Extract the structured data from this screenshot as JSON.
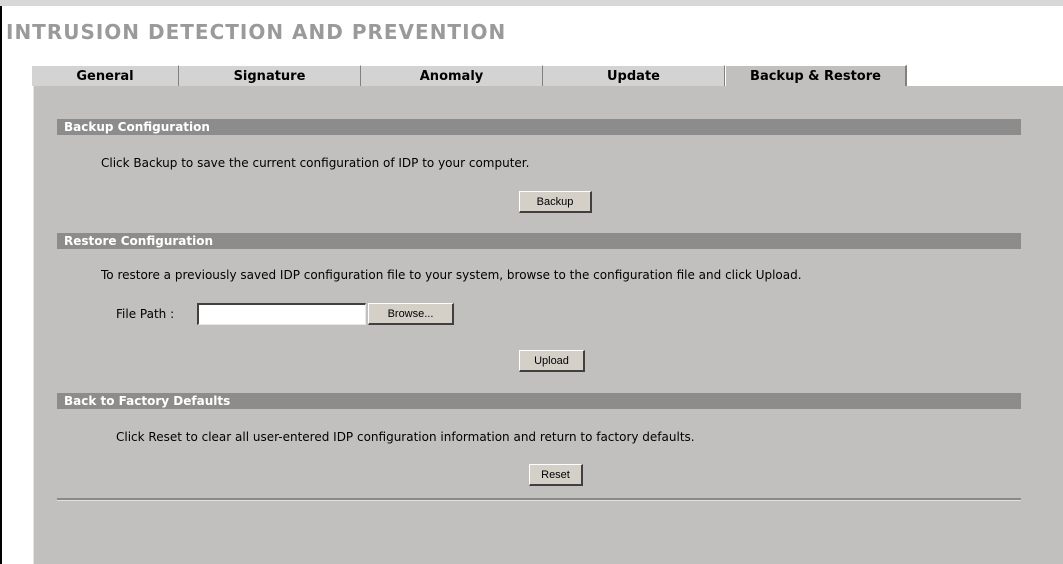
{
  "page": {
    "title": "INTRUSION DETECTION AND PREVENTION"
  },
  "tabs": [
    {
      "label": "General"
    },
    {
      "label": "Signature"
    },
    {
      "label": "Anomaly"
    },
    {
      "label": "Update"
    },
    {
      "label": "Backup & Restore",
      "active": true
    }
  ],
  "backup": {
    "header": "Backup Configuration",
    "description": "Click Backup to save the current configuration of IDP to your computer.",
    "button_label": "Backup"
  },
  "restore": {
    "header": "Restore Configuration",
    "description": "To restore a previously saved IDP configuration file to your system, browse to the configuration file and click Upload.",
    "file_path_label": "File Path :",
    "file_path_value": "",
    "browse_label": "Browse...",
    "upload_label": "Upload"
  },
  "factory": {
    "header": "Back to Factory Defaults",
    "description": "Click Reset to clear all user-entered IDP configuration information and return to factory defaults.",
    "reset_label": "Reset"
  },
  "colors": {
    "panel_bg": "#c2bfbf",
    "section_header_bg": "#8c8c8c",
    "title_color": "#9a9a9a"
  }
}
